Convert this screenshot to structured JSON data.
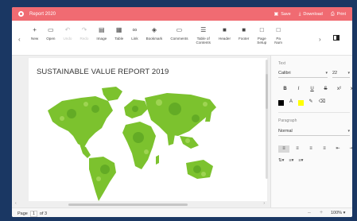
{
  "titlebar": {
    "title": "Report 2020",
    "actions": [
      {
        "icon": "save-icon",
        "glyph": "▣",
        "label": "Save"
      },
      {
        "icon": "download-icon",
        "glyph": "⤓",
        "label": "Download"
      },
      {
        "icon": "print-icon",
        "glyph": "⎙",
        "label": "Print"
      }
    ]
  },
  "ribbon": {
    "tools": [
      {
        "name": "new",
        "icon": "plus-icon",
        "glyph": "+",
        "label": "New",
        "enabled": true
      },
      {
        "name": "open",
        "icon": "folder-icon",
        "glyph": "▭",
        "label": "Open",
        "enabled": true
      },
      {
        "name": "undo",
        "icon": "undo-icon",
        "glyph": "↶",
        "label": "Undo",
        "enabled": false
      },
      {
        "name": "redo",
        "icon": "redo-icon",
        "glyph": "↷",
        "label": "Redo",
        "enabled": false
      },
      {
        "name": "image",
        "icon": "image-icon",
        "glyph": "▤",
        "label": "Image",
        "enabled": true
      },
      {
        "name": "table",
        "icon": "table-icon",
        "glyph": "▦",
        "label": "Table",
        "enabled": true
      },
      {
        "name": "link",
        "icon": "link-icon",
        "glyph": "∞",
        "label": "Link",
        "enabled": true
      },
      {
        "name": "bookmark",
        "icon": "bookmark-icon",
        "glyph": "◈",
        "label": "Bookmark",
        "enabled": true
      },
      {
        "name": "comments",
        "icon": "comment-icon",
        "glyph": "▭",
        "label": "Comments",
        "enabled": true
      },
      {
        "name": "toc",
        "icon": "toc-icon",
        "glyph": "☰",
        "label": "Table of\nContents",
        "enabled": true
      },
      {
        "name": "header",
        "icon": "header-icon",
        "glyph": "■",
        "label": "Header",
        "enabled": true
      },
      {
        "name": "footer",
        "icon": "footer-icon",
        "glyph": "■",
        "label": "Footer",
        "enabled": true
      },
      {
        "name": "page-setup",
        "icon": "page-setup-icon",
        "glyph": "□",
        "label": "Page\nSetup",
        "enabled": true
      },
      {
        "name": "page-number",
        "icon": "page-number-icon",
        "glyph": "□",
        "label": "Pa\nNum",
        "enabled": true
      }
    ]
  },
  "document": {
    "title": "SUSTAINABLE VALUE REPORT 2019"
  },
  "panel": {
    "text_label": "Text",
    "font_family": "Calibri",
    "font_size": "22",
    "format_buttons": [
      {
        "icon": "bold-icon",
        "glyph": "B",
        "on": false
      },
      {
        "icon": "italic-icon",
        "glyph": "I",
        "on": false
      },
      {
        "icon": "underline-icon",
        "glyph": "U",
        "on": false
      },
      {
        "icon": "strikethrough-icon",
        "glyph": "S",
        "on": false
      },
      {
        "icon": "superscript-icon",
        "glyph": "x²",
        "on": false
      },
      {
        "icon": "subscript-icon",
        "glyph": "x₂",
        "on": false
      }
    ],
    "font_color": "#000000",
    "highlight_color": "#ffff00",
    "paragraph_label": "Paragraph",
    "paragraph_style": "Normal",
    "align_buttons": [
      {
        "icon": "align-left-icon",
        "glyph": "≡",
        "on": true
      },
      {
        "icon": "align-center-icon",
        "glyph": "≡",
        "on": false
      },
      {
        "icon": "align-right-icon",
        "glyph": "≡",
        "on": false
      },
      {
        "icon": "align-justify-icon",
        "glyph": "≡",
        "on": false
      },
      {
        "icon": "indent-decrease-icon",
        "glyph": "⇤",
        "on": false
      },
      {
        "icon": "indent-increase-icon",
        "glyph": "⇥",
        "on": false
      }
    ]
  },
  "status": {
    "page_label": "Page",
    "page_current": "1",
    "page_of": "of 3",
    "zoom": "100%"
  },
  "colors": {
    "titlebar": "#f06b72",
    "background": "#1a3763",
    "map_green": "#7cc22e"
  }
}
